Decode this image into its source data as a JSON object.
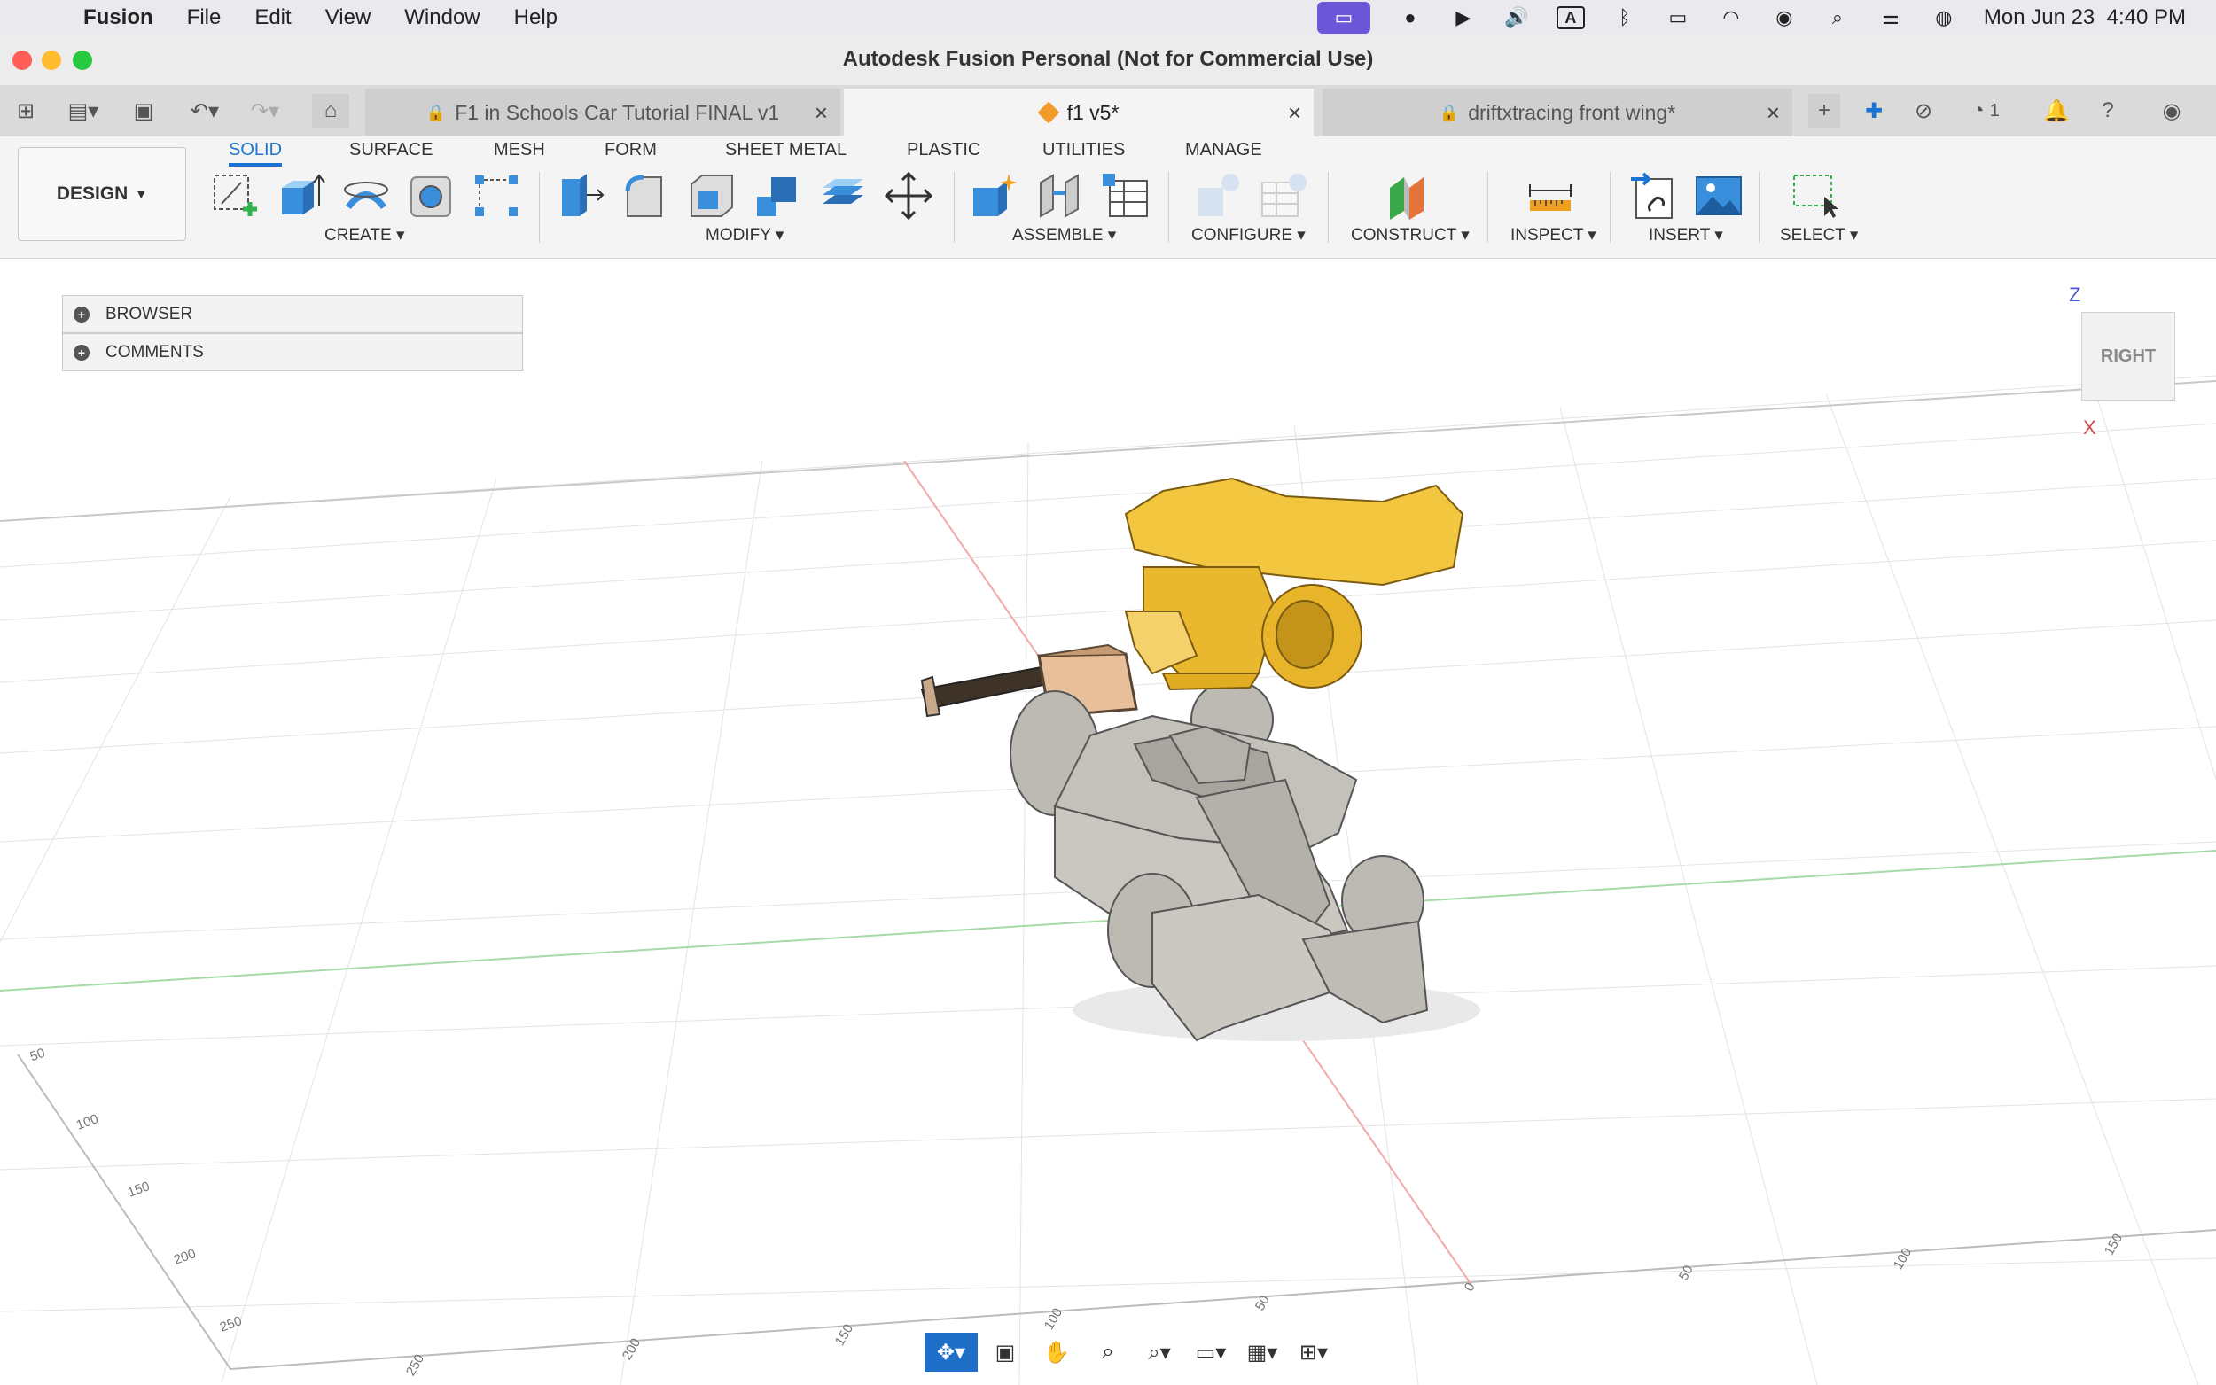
{
  "menubar": {
    "app_name": "Fusion",
    "items": [
      "File",
      "Edit",
      "View",
      "Window",
      "Help"
    ],
    "clock": "Mon Jun 23  4:40 PM",
    "input_indicator": "A"
  },
  "window": {
    "title": "Autodesk Fusion Personal (Not for Commercial Use)"
  },
  "tabs": [
    {
      "label": "F1 in Schools Car Tutorial FINAL v1",
      "locked": true
    },
    {
      "label": "f1 v5*",
      "locked": false
    },
    {
      "label": "driftxtracing front wing*",
      "locked": true
    }
  ],
  "tabbar_right": {
    "jobs_count": "1"
  },
  "toolbar": {
    "workspace": "DESIGN",
    "workspace_tabs": [
      "SOLID",
      "SURFACE",
      "MESH",
      "FORM",
      "SHEET METAL",
      "PLASTIC",
      "UTILITIES",
      "MANAGE"
    ],
    "groups": [
      "CREATE",
      "MODIFY",
      "ASSEMBLE",
      "CONFIGURE",
      "CONSTRUCT",
      "INSPECT",
      "INSERT",
      "SELECT"
    ]
  },
  "panels": {
    "browser": "BROWSER",
    "comments": "COMMENTS"
  },
  "viewcube": {
    "face": "RIGHT",
    "axis_z": "Z",
    "axis_x": "X"
  },
  "grid_labels": {
    "left": [
      "50",
      "100",
      "150",
      "200",
      "250"
    ],
    "bottom": [
      "250",
      "200",
      "150",
      "100",
      "50",
      "0",
      "50",
      "100",
      "150"
    ]
  },
  "colors": {
    "accent": "#1a73d1",
    "wing_yellow": "#f0c33a",
    "car_grey": "#b7b4ae"
  }
}
